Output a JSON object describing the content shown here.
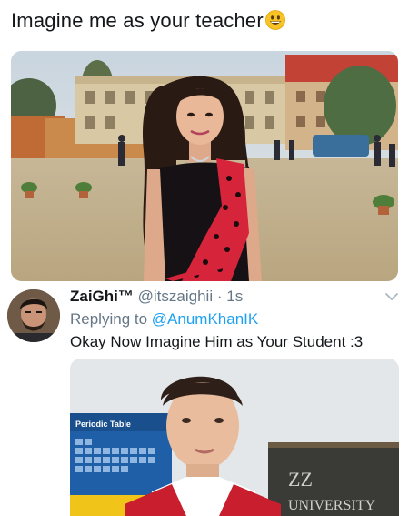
{
  "tweet": {
    "text": "Imagine me as your teacher",
    "emoji": "grinning-face"
  },
  "reply": {
    "display_name": "ZaiGhi™",
    "handle": "@itszaighii",
    "separator": "·",
    "time": "1s",
    "replying_prefix": "Replying to",
    "replying_to": "@AnumKhanIK",
    "text": "Okay Now Imagine Him as Your Student :3"
  },
  "photo2": {
    "poster_text": "Periodic Table",
    "board_line1": "ZZ",
    "board_line2": "UNIVERSITY"
  },
  "colors": {
    "text": "#14171a",
    "secondary": "#657786",
    "link": "#1da1f2",
    "saree_red": "#d6243a"
  }
}
